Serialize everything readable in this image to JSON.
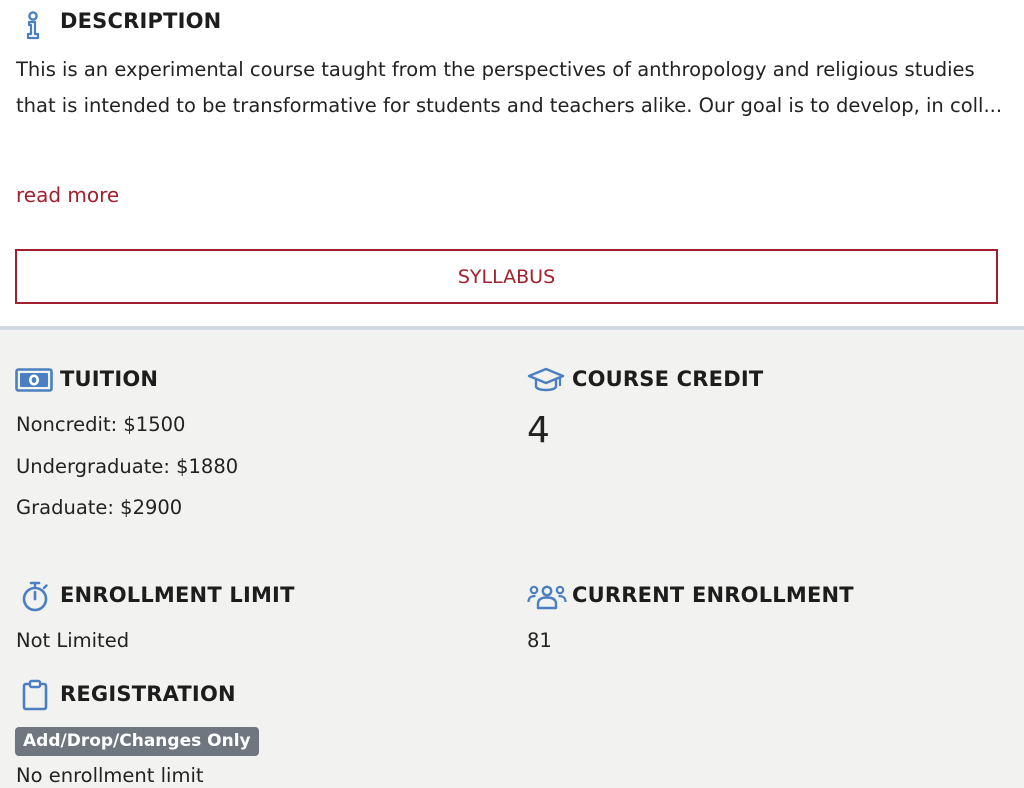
{
  "description": {
    "icon": "info-icon",
    "heading": "DESCRIPTION",
    "text": "This is an experimental course taught from the perspectives of anthropology and religious studies that is intended to be transformative for students and teachers alike. Our goal is to develop, in coll...",
    "read_more": "read more"
  },
  "syllabus": {
    "label": "SYLLABUS"
  },
  "tuition": {
    "icon": "money-icon",
    "heading": "TUITION",
    "lines": [
      "Noncredit: $1500",
      "Undergraduate: $1880",
      "Graduate: $2900"
    ]
  },
  "course_credit": {
    "icon": "graduation-cap-icon",
    "heading": "COURSE CREDIT",
    "value": "4"
  },
  "enrollment_limit": {
    "icon": "stopwatch-icon",
    "heading": "ENROLLMENT LIMIT",
    "value": "Not Limited"
  },
  "current_enrollment": {
    "icon": "users-icon",
    "heading": "CURRENT ENROLLMENT",
    "value": "81"
  },
  "registration": {
    "icon": "clipboard-icon",
    "heading": "REGISTRATION",
    "badge": "Add/Drop/Changes Only",
    "note": "No enrollment limit"
  },
  "colors": {
    "accent_red": "#a1202f",
    "icon_blue": "#4a7fc1",
    "panel_gray": "#f2f2f0",
    "badge_gray": "#6f7680"
  }
}
